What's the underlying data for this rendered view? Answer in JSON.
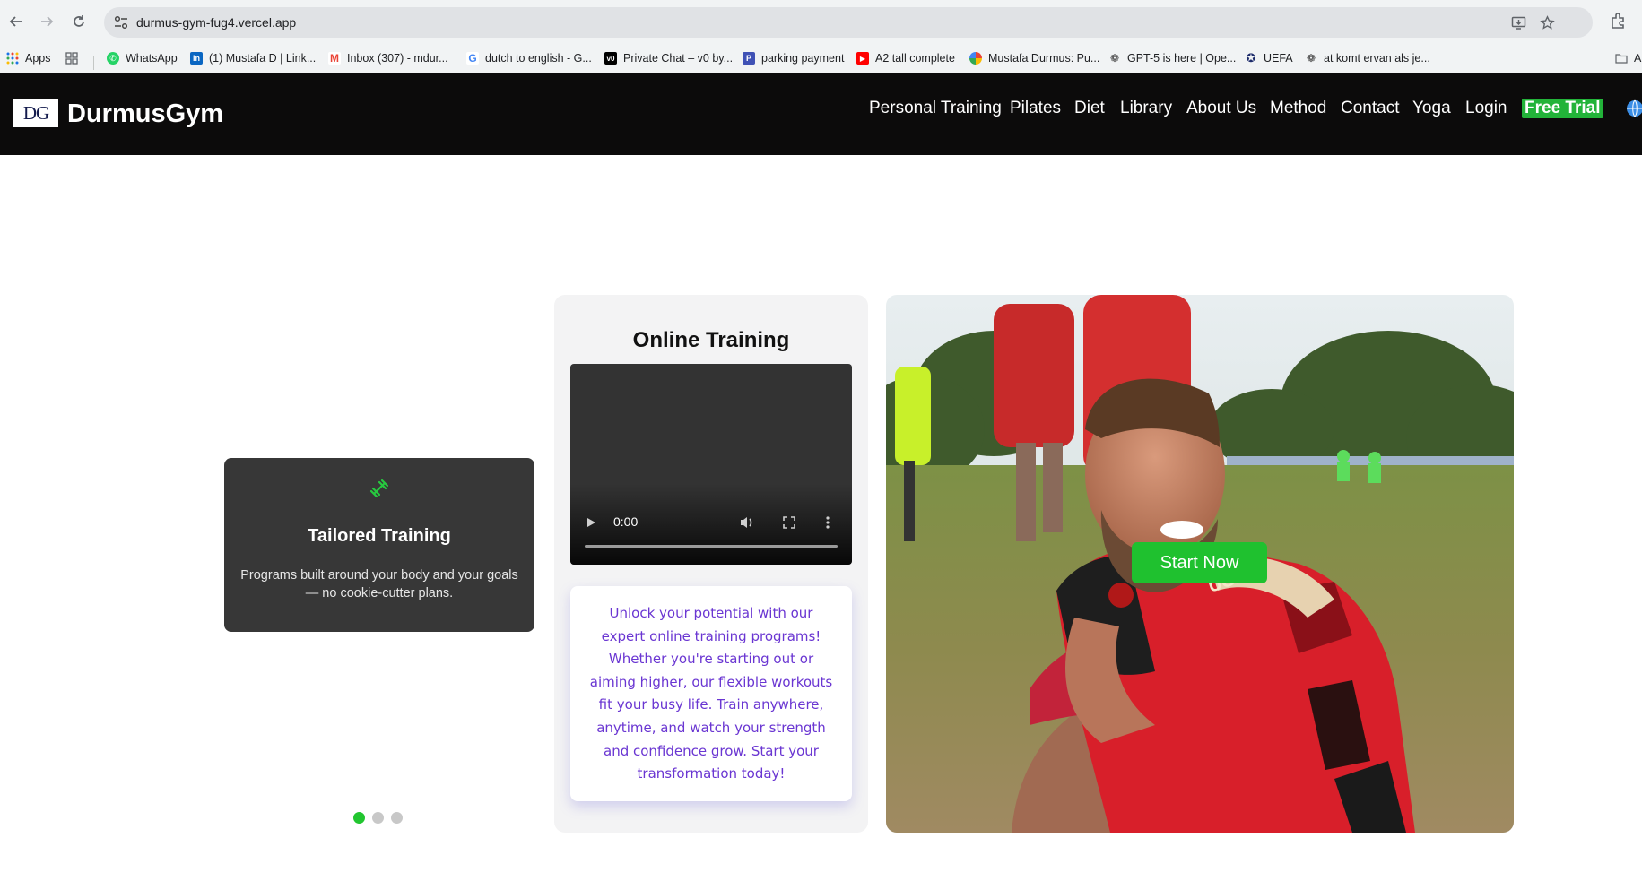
{
  "browser": {
    "url": "durmus-gym-fug4.vercel.app",
    "bookmarks": [
      {
        "label": "Apps",
        "icon": "apps-grid-icon"
      },
      {
        "label": "",
        "icon": "tab-groups-icon"
      },
      {
        "label": "WhatsApp",
        "icon": "whatsapp-icon"
      },
      {
        "label": "(1) Mustafa D | Link...",
        "icon": "linkedin-icon"
      },
      {
        "label": "Inbox (307) - mdur...",
        "icon": "gmail-icon"
      },
      {
        "label": "dutch to english - G...",
        "icon": "google-icon"
      },
      {
        "label": "Private Chat – v0 by...",
        "icon": "v0-icon"
      },
      {
        "label": "parking payment",
        "icon": "parking-icon"
      },
      {
        "label": "A2 tall complete",
        "icon": "youtube-icon"
      },
      {
        "label": "Mustafa Durmus: Pu...",
        "icon": "photos-icon"
      },
      {
        "label": "GPT-5 is here | Ope...",
        "icon": "openai-icon"
      },
      {
        "label": "UEFA",
        "icon": "uefa-icon"
      },
      {
        "label": "at komt ervan als je...",
        "icon": "openai-icon"
      },
      {
        "label": "A",
        "icon": "folder-icon"
      }
    ]
  },
  "site": {
    "logo_text": "DG",
    "brand": "DurmusGym",
    "nav": [
      {
        "label": "Personal Training"
      },
      {
        "label": "Pilates"
      },
      {
        "label": "Diet"
      },
      {
        "label": "Library"
      },
      {
        "label": "About Us"
      },
      {
        "label": "Method"
      },
      {
        "label": "Contact"
      },
      {
        "label": "Yoga"
      },
      {
        "label": "Login"
      },
      {
        "label": "Free Trial"
      }
    ]
  },
  "feature_card": {
    "icon": "dumbbell-icon",
    "title": "Tailored Training",
    "description": "Programs built around your body and your goals — no cookie-cutter plans."
  },
  "carousel": {
    "slides": 3,
    "active_index": 0
  },
  "online_training": {
    "title": "Online Training",
    "video_time": "0:00",
    "promo": "Unlock your potential with our expert online training programs! Whether you're starting out or aiming higher, our flexible workouts fit your busy life. Train anywhere, anytime, and watch your strength and confidence grow. Start your transformation today!"
  },
  "hero": {
    "cta": "Start Now"
  },
  "colors": {
    "header_bg": "#0c0b0b",
    "accent_green": "#22b339",
    "promo_text": "#6a36d2",
    "card_bg": "#373737"
  }
}
